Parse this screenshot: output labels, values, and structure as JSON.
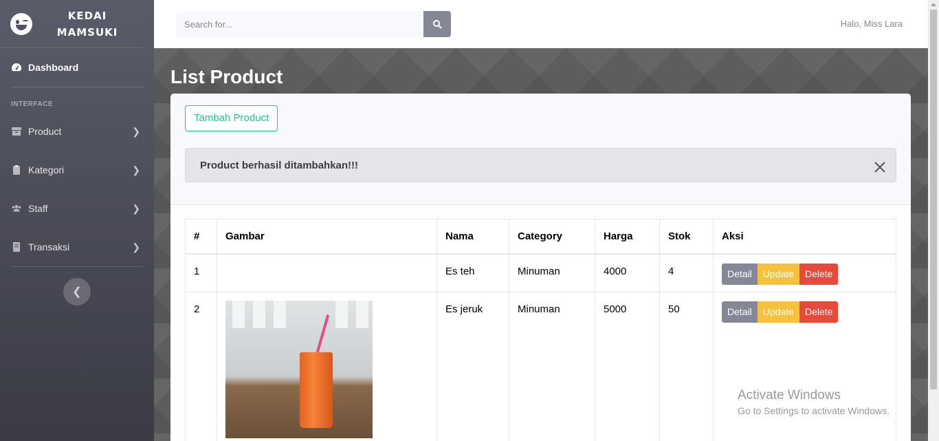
{
  "brand": {
    "name": "KEDAI MAMSUKI"
  },
  "sidebar": {
    "dashboard_label": "Dashboard",
    "heading": "INTERFACE",
    "items": [
      {
        "label": "Product",
        "icon": "box-icon"
      },
      {
        "label": "Kategori",
        "icon": "clipboard-icon"
      },
      {
        "label": "Staff",
        "icon": "users-icon"
      },
      {
        "label": "Transaksi",
        "icon": "book-icon"
      }
    ]
  },
  "topbar": {
    "search_placeholder": "Search for...",
    "greeting": "Halo, Miss Lara"
  },
  "page": {
    "title": "List Product",
    "add_button": "Tambah Product",
    "alert_message": "Product berhasil ditambahkan!!!"
  },
  "table": {
    "headers": [
      "#",
      "Gambar",
      "Nama",
      "Category",
      "Harga",
      "Stok",
      "Aksi"
    ],
    "rows": [
      {
        "no": "1",
        "image": "",
        "nama": "Es teh",
        "category": "Minuman",
        "harga": "4000",
        "stok": "4"
      },
      {
        "no": "2",
        "image": "orange-juice-photo",
        "nama": "Es jeruk",
        "category": "Minuman",
        "harga": "5000",
        "stok": "50"
      }
    ],
    "actions": {
      "detail": "Detail",
      "update": "Update",
      "delete": "Delete"
    }
  },
  "watermark": {
    "line1": "Activate Windows",
    "line2": "Go to Settings to activate Windows."
  },
  "colors": {
    "sidebar": "#4e5060",
    "success": "#1cc88a",
    "warning": "#f6c23e",
    "danger": "#e74a3b",
    "secondary": "#858796"
  }
}
